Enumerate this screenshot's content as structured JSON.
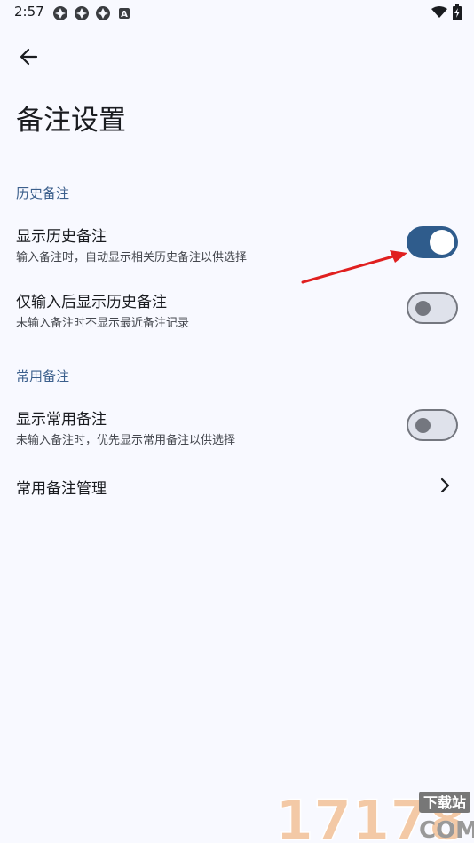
{
  "status_bar": {
    "time": "2:57",
    "badge_letter": "A",
    "icons": [
      "app-notification-icon",
      "app-notification-icon",
      "app-notification-icon",
      "a-notification-icon",
      "wifi-icon",
      "battery-charging-icon"
    ]
  },
  "toolbar": {
    "back_icon": "arrow-back-icon",
    "title": "备注设置"
  },
  "sections": {
    "history": {
      "header": "历史备注",
      "show_history": {
        "title": "显示历史备注",
        "summary": "输入备注时，自动显示相关历史备注以供选择",
        "enabled": true
      },
      "show_after_input": {
        "title": "仅输入后显示历史备注",
        "summary": "未输入备注时不显示最近备注记录",
        "enabled": false
      }
    },
    "common": {
      "header": "常用备注",
      "show_common": {
        "title": "显示常用备注",
        "summary": "未输入备注时，优先显示常用备注以供选择",
        "enabled": false
      },
      "manage": {
        "title": "常用备注管理",
        "icon": "chevron-right-icon"
      }
    }
  },
  "annotation": {
    "arrow_color": "#e02020"
  },
  "watermark": {
    "digits": "17178",
    "top_text": "下载站",
    "bottom_text": "COM"
  },
  "colors": {
    "background": "#f8f9ff",
    "accent": "#2f5c8c",
    "section_header": "#3b5f8c"
  }
}
